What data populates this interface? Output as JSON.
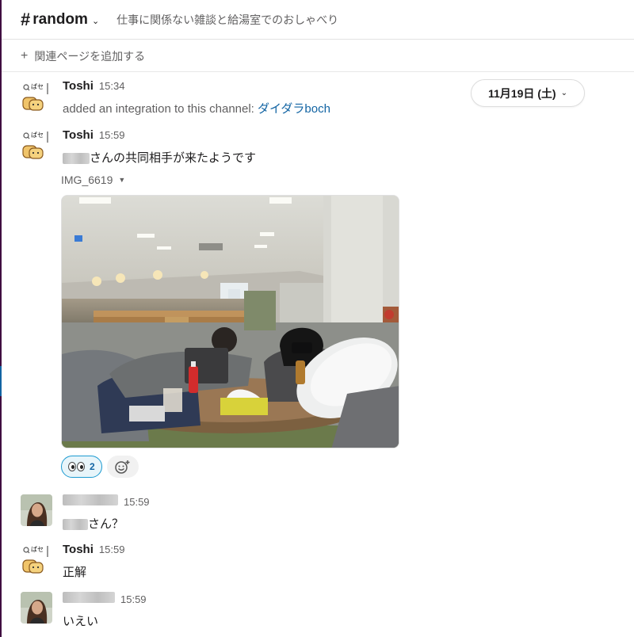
{
  "header": {
    "hash": "#",
    "channel": "random",
    "chevron": "⌄",
    "topic": "仕事に関係ない雑談と給湯室でのおしゃべり"
  },
  "bookmarks": {
    "plus": "+",
    "label": "関連ページを追加する"
  },
  "date_divider": {
    "label": "11月19日 (土)",
    "chevron": "⌄"
  },
  "messages": [
    {
      "author": "Toshi",
      "time": "15:34",
      "text_prefix": "added an integration to this channel: ",
      "link": "ダイダラboch"
    },
    {
      "author": "Toshi",
      "time": "15:59",
      "text_suffix": "さんの共同相手が来たようです",
      "file": {
        "name": "IMG_6619",
        "caret": "▼"
      },
      "reactions": [
        {
          "emoji": "eyes",
          "count": "2"
        }
      ],
      "add_reaction_icon": "emoji-add-icon"
    },
    {
      "author": "",
      "time": "15:59",
      "text_suffix": "さん？"
    },
    {
      "author": "Toshi",
      "time": "15:59",
      "text": "正解"
    },
    {
      "author": "",
      "time": "15:59",
      "text": "いえい"
    }
  ],
  "colors": {
    "sidebar_edge": "#3f0e40",
    "link": "#1264a3",
    "muted": "#616061",
    "reaction_border": "#1d9bd1"
  }
}
